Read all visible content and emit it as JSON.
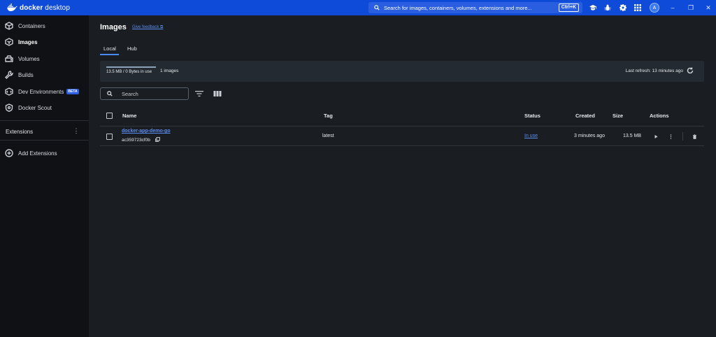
{
  "titlebar": {
    "logo_bold": "docker",
    "logo_light": " desktop",
    "search_placeholder": "Search for images, containers, volumes, extensions and more...",
    "shortcut": "Ctrl+K",
    "avatar_letter": "A",
    "icons": [
      "graduation-cap-icon",
      "bug-icon",
      "gear-icon",
      "grid-icon"
    ],
    "window_controls": [
      "–",
      "❐",
      "✕"
    ]
  },
  "sidebar": {
    "items": [
      {
        "label": "Containers",
        "icon": "container-icon"
      },
      {
        "label": "Images",
        "icon": "image-icon",
        "active": true
      },
      {
        "label": "Volumes",
        "icon": "volume-icon"
      },
      {
        "label": "Builds",
        "icon": "wrench-icon"
      },
      {
        "label": "Dev Environments",
        "icon": "dev-env-icon",
        "badge": "BETA"
      },
      {
        "label": "Docker Scout",
        "icon": "scout-icon"
      }
    ],
    "extensions_title": "Extensions",
    "add_extensions": "Add Extensions"
  },
  "main": {
    "title": "Images",
    "feedback": "Give feedback ⧉",
    "tabs": [
      {
        "label": "Local",
        "active": true
      },
      {
        "label": "Hub"
      }
    ],
    "usage": {
      "text": "13.5 MB / 0 Bytes in use",
      "count": "1 images",
      "fill_fraction": 1.0
    },
    "last_refresh": "Last refresh: 13 minutes ago",
    "search_placeholder": "Search",
    "table": {
      "headers": [
        "Name",
        "Tag",
        "Status",
        "Created",
        "Size",
        "Actions"
      ],
      "rows": [
        {
          "name": "docker-app-demo-go",
          "id": "ac359723cf0b",
          "tag": "latest",
          "status": "In use",
          "created": "3 minutes ago",
          "size": "13.5 MB"
        }
      ]
    }
  },
  "colors": {
    "titlebar": "#0e4bd8",
    "sidebar": "#0f1114",
    "main": "#1a1e23",
    "accent": "#4a8af4",
    "link": "#5b8def"
  }
}
